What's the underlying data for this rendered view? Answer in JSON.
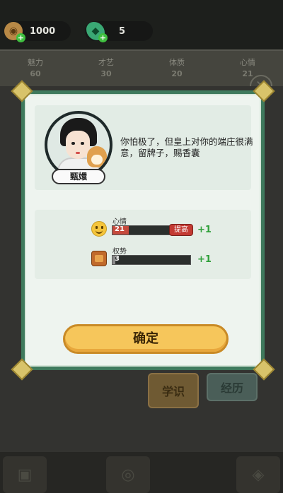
{
  "hud": {
    "coins": "1000",
    "gems": "5"
  },
  "stats": [
    {
      "label": "魅力",
      "value": "60"
    },
    {
      "label": "才艺",
      "value": "30"
    },
    {
      "label": "体质",
      "value": "20"
    },
    {
      "label": "心情",
      "value": "21"
    }
  ],
  "background_buttons": {
    "study": "学识",
    "experience": "经历"
  },
  "dialog": {
    "character_name": "甄嬛",
    "message": "你怕极了，但皇上对你的端庄很满意，留牌子，赐香囊",
    "attributes": [
      {
        "label": "心情",
        "value": "21",
        "boost_label": "提高",
        "delta": "+1",
        "fill": 0.21
      },
      {
        "label": "权势",
        "value": "3",
        "delta": "+1",
        "fill": 0.03
      }
    ],
    "confirm_label": "确定"
  },
  "colors": {
    "dialog_frame": "#3f7a5d",
    "confirm": "#f6c65b",
    "boost": "#c33a33",
    "plus": "#2fa03a"
  }
}
